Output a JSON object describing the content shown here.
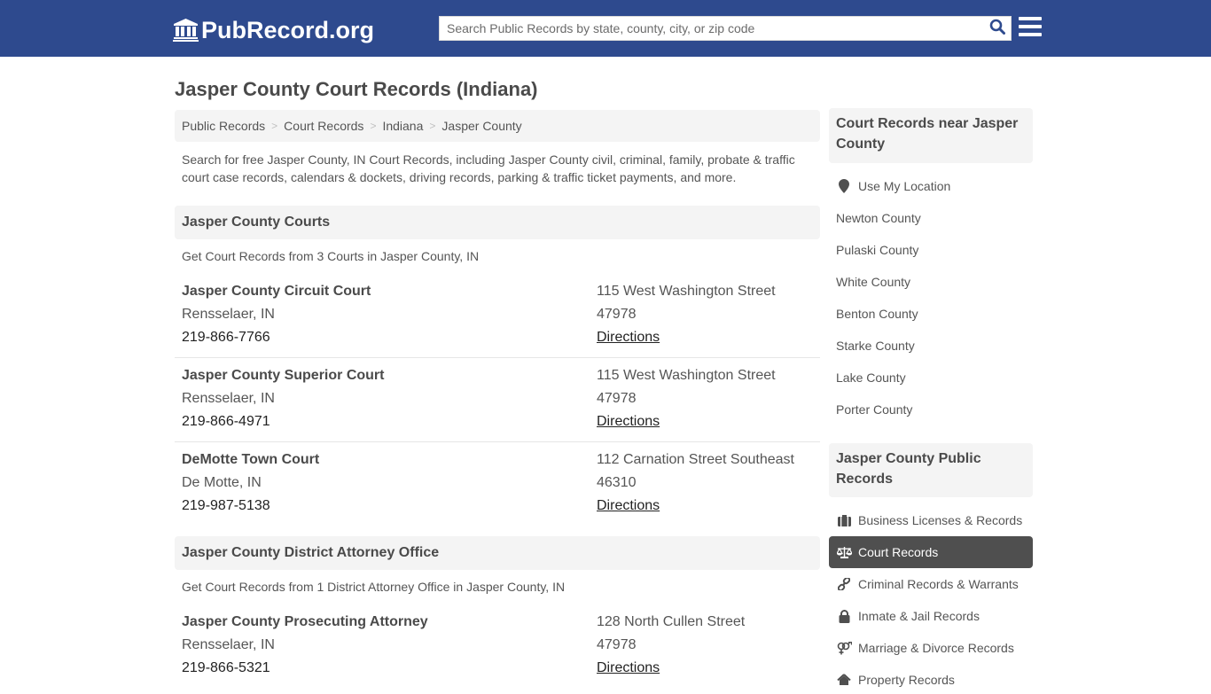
{
  "header": {
    "logo_text": "PubRecord.org",
    "logo_icon": "courthouse-icon",
    "search_placeholder": "Search Public Records by state, county, city, or zip code",
    "search_value": "",
    "search_icon": "search-icon",
    "menu_icon": "hamburger-menu-icon"
  },
  "colors": {
    "brand_blue": "#2e4a8e",
    "active_item_bg": "#4f4f4f",
    "panel_bg": "#f4f4f4"
  },
  "page": {
    "title": "Jasper County Court Records (Indiana)",
    "breadcrumb": [
      {
        "label": "Public Records"
      },
      {
        "label": "Court Records"
      },
      {
        "label": "Indiana"
      },
      {
        "label": "Jasper County"
      }
    ],
    "breadcrumb_separator": ">",
    "intro": "Search for free Jasper County, IN Court Records, including Jasper County civil, criminal, family, probate & traffic court case records, calendars & dockets, driving records, parking & traffic ticket payments, and more."
  },
  "sections": [
    {
      "heading": "Jasper County Courts",
      "subtitle": "Get Court Records from 3 Courts in Jasper County, IN",
      "entries": [
        {
          "name": "Jasper County Circuit Court",
          "city": "Rensselaer, IN",
          "phone": "219-866-7766",
          "address": "115 West Washington Street",
          "zip": "47978",
          "directions": "Directions"
        },
        {
          "name": "Jasper County Superior Court",
          "city": "Rensselaer, IN",
          "phone": "219-866-4971",
          "address": "115 West Washington Street",
          "zip": "47978",
          "directions": "Directions"
        },
        {
          "name": "DeMotte Town Court",
          "city": "De Motte, IN",
          "phone": "219-987-5138",
          "address": "112 Carnation Street Southeast",
          "zip": "46310",
          "directions": "Directions"
        }
      ]
    },
    {
      "heading": "Jasper County District Attorney Office",
      "subtitle": "Get Court Records from 1 District Attorney Office in Jasper County, IN",
      "entries": [
        {
          "name": "Jasper County Prosecuting Attorney",
          "city": "Rensselaer, IN",
          "phone": "219-866-5321",
          "address": "128 North Cullen Street",
          "zip": "47978",
          "directions": "Directions"
        }
      ]
    }
  ],
  "sidebar": {
    "nearby": {
      "heading": "Court Records near Jasper County",
      "use_location": {
        "label": "Use My Location",
        "icon": "map-marker-icon"
      },
      "counties": [
        "Newton County",
        "Pulaski County",
        "White County",
        "Benton County",
        "Starke County",
        "Lake County",
        "Porter County"
      ]
    },
    "public_records": {
      "heading": "Jasper County Public Records",
      "items": [
        {
          "label": "Business Licenses & Records",
          "icon": "briefcase-icon",
          "active": false
        },
        {
          "label": "Court Records",
          "icon": "balance-scale-icon",
          "active": true
        },
        {
          "label": "Criminal Records & Warrants",
          "icon": "link-icon",
          "active": false
        },
        {
          "label": "Inmate & Jail Records",
          "icon": "lock-icon",
          "active": false
        },
        {
          "label": "Marriage & Divorce Records",
          "icon": "venus-mars-icon",
          "active": false
        },
        {
          "label": "Property Records",
          "icon": "home-icon",
          "active": false
        }
      ]
    }
  }
}
